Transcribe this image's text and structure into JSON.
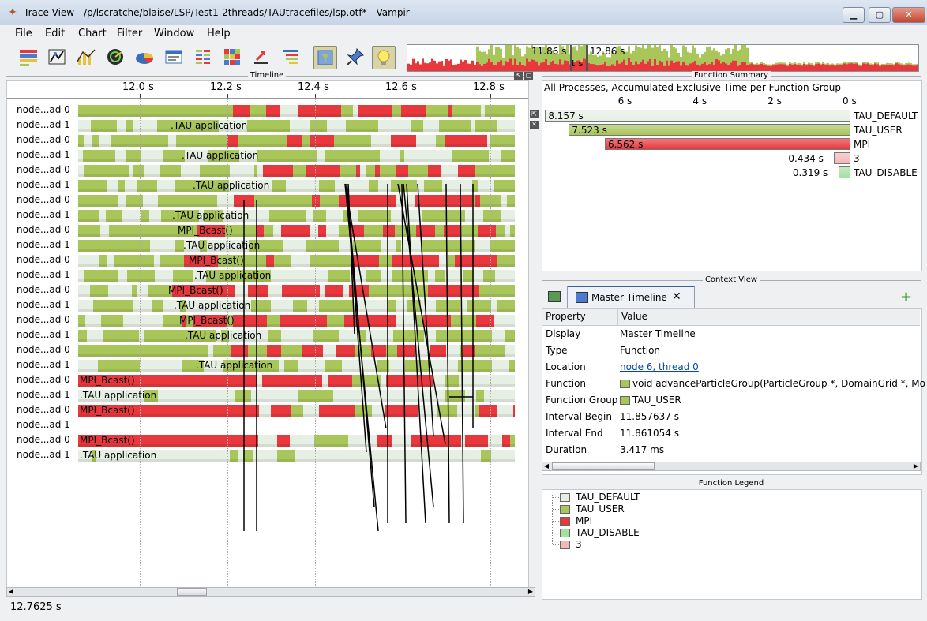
{
  "window": {
    "title": "Trace View - /p/lscratche/blaise/LSP/Test1-2threads/TAUtracefiles/lsp.otf* - Vampir",
    "minimize": "▁",
    "maximize": "▢",
    "close": "✕"
  },
  "menu": [
    "File",
    "Edit",
    "Chart",
    "Filter",
    "Window",
    "Help"
  ],
  "toolbar": {
    "icons": [
      "master-timeline-icon",
      "process-timeline-icon",
      "counter-timeline-icon",
      "performance-radar-icon",
      "function-summary-icon",
      "message-summary-icon",
      "process-summary-icon",
      "communication-matrix-icon",
      "io-events-icon",
      "call-tree-icon",
      "filter-icon",
      "pin-icon",
      "lightbulb-icon"
    ],
    "overview": {
      "left_time": "11.86 s",
      "right_time": "12.86 s",
      "span": "1 s"
    }
  },
  "colors": {
    "TAU_DEFAULT": "#e6efe3",
    "TAU_USER": "#a8c65a",
    "MPI": "#e8383d",
    "TAU_DISABLE": "#a6e0a0",
    "GROUP_3": "#f2b8b8",
    "message_line": "#000000"
  },
  "timeline": {
    "panel_title": "Timeline",
    "ticks": [
      "12.0 s",
      "12.2 s",
      "12.4 s",
      "12.6 s",
      "12.8 s"
    ],
    "rows": [
      {
        "label": "node...ad 0",
        "pattern": "mpi_heavy",
        "text": ""
      },
      {
        "label": "node...ad 1",
        "pattern": "user_app",
        "text": ".TAU application"
      },
      {
        "label": "node...ad 0",
        "pattern": "mpi_heavy",
        "text": ""
      },
      {
        "label": "node...ad 1",
        "pattern": "user_app",
        "text": ".TAU application"
      },
      {
        "label": "node...ad 0",
        "pattern": "mpi_heavy",
        "text": ""
      },
      {
        "label": "node...ad 1",
        "pattern": "user_app",
        "text": ".TAU application"
      },
      {
        "label": "node...ad 0",
        "pattern": "mpi_heavy",
        "text": ""
      },
      {
        "label": "node...ad 1",
        "pattern": "user_app",
        "text": ".TAU application"
      },
      {
        "label": "node...ad 0",
        "pattern": "mpi_bcast",
        "text": "MPI_Bcast()"
      },
      {
        "label": "node...ad 1",
        "pattern": "user_app",
        "text": ".TAU application"
      },
      {
        "label": "node...ad 0",
        "pattern": "mpi_bcast",
        "text": "MPI_Bcast()"
      },
      {
        "label": "node...ad 1",
        "pattern": "user_app",
        "text": ".TAU application"
      },
      {
        "label": "node...ad 0",
        "pattern": "mpi_bcast",
        "text": "MPI_Bcast()"
      },
      {
        "label": "node...ad 1",
        "pattern": "user_app",
        "text": ".TAU application"
      },
      {
        "label": "node...ad 0",
        "pattern": "mpi_bcast",
        "text": "MPI_Bcast()"
      },
      {
        "label": "node...ad 1",
        "pattern": "user_app",
        "text": ".TAU application"
      },
      {
        "label": "node...ad 0",
        "pattern": "mpi_heavy",
        "text": ""
      },
      {
        "label": "node...ad 1",
        "pattern": "user_app",
        "text": ".TAU application"
      },
      {
        "label": "node...ad 0",
        "pattern": "mpi_left",
        "text": "MPI_Bcast()"
      },
      {
        "label": "node...ad 1",
        "pattern": "default_app",
        "text": ".TAU application"
      },
      {
        "label": "node...ad 0",
        "pattern": "mpi_left",
        "text": "MPI_Bcast()"
      },
      {
        "label": "node...ad 1",
        "pattern": "empty",
        "text": ""
      },
      {
        "label": "node...ad 0",
        "pattern": "mpi_left",
        "text": "MPI_Bcast()"
      },
      {
        "label": "node...ad 1",
        "pattern": "default_app",
        "text": ".TAU application"
      }
    ]
  },
  "function_summary": {
    "panel_title": "Function Summary",
    "subtitle": "All Processes, Accumulated Exclusive Time per Function Group",
    "axis_ticks": [
      "6 s",
      "4 s",
      "2 s",
      "0 s"
    ],
    "axis_max": 8.157,
    "bars": [
      {
        "name": "TAU_DEFAULT",
        "value": 8.157,
        "label": "8.157 s",
        "color_key": "TAU_DEFAULT"
      },
      {
        "name": "TAU_USER",
        "value": 7.523,
        "label": "7.523 s",
        "color_key": "TAU_USER"
      },
      {
        "name": "MPI",
        "value": 6.562,
        "label": "6.562 s",
        "color_key": "MPI"
      },
      {
        "name": "3",
        "value": 0.434,
        "label": "0.434 s",
        "color_key": "GROUP_3"
      },
      {
        "name": "TAU_DISABLE",
        "value": 0.319,
        "label": "0.319 s",
        "color_key": "TAU_DISABLE"
      }
    ]
  },
  "context_view": {
    "panel_title": "Context View",
    "tab_label": "Master Timeline",
    "headers": {
      "property": "Property",
      "value": "Value"
    },
    "rows": [
      {
        "property": "Display",
        "value": "Master Timeline",
        "kind": "text"
      },
      {
        "property": "Type",
        "value": "Function",
        "kind": "text"
      },
      {
        "property": "Location",
        "value": "node 6, thread 0",
        "kind": "link"
      },
      {
        "property": "Function",
        "value": "void advanceParticleGroup(ParticleGroup *, DomainGrid *, Mo",
        "kind": "swatch"
      },
      {
        "property": "Function Group",
        "value": "TAU_USER",
        "kind": "swatch"
      },
      {
        "property": "Interval Begin",
        "value": "11.857637 s",
        "kind": "text"
      },
      {
        "property": "Interval End",
        "value": "11.861054 s",
        "kind": "text"
      },
      {
        "property": "Duration",
        "value": "3.417 ms",
        "kind": "text"
      }
    ]
  },
  "function_legend": {
    "panel_title": "Function Legend",
    "items": [
      {
        "name": "TAU_DEFAULT",
        "color_key": "TAU_DEFAULT"
      },
      {
        "name": "TAU_USER",
        "color_key": "TAU_USER"
      },
      {
        "name": "MPI",
        "color_key": "MPI"
      },
      {
        "name": "TAU_DISABLE",
        "color_key": "TAU_DISABLE"
      },
      {
        "name": "3",
        "color_key": "GROUP_3"
      }
    ]
  },
  "status": {
    "time": "12.7625 s"
  }
}
